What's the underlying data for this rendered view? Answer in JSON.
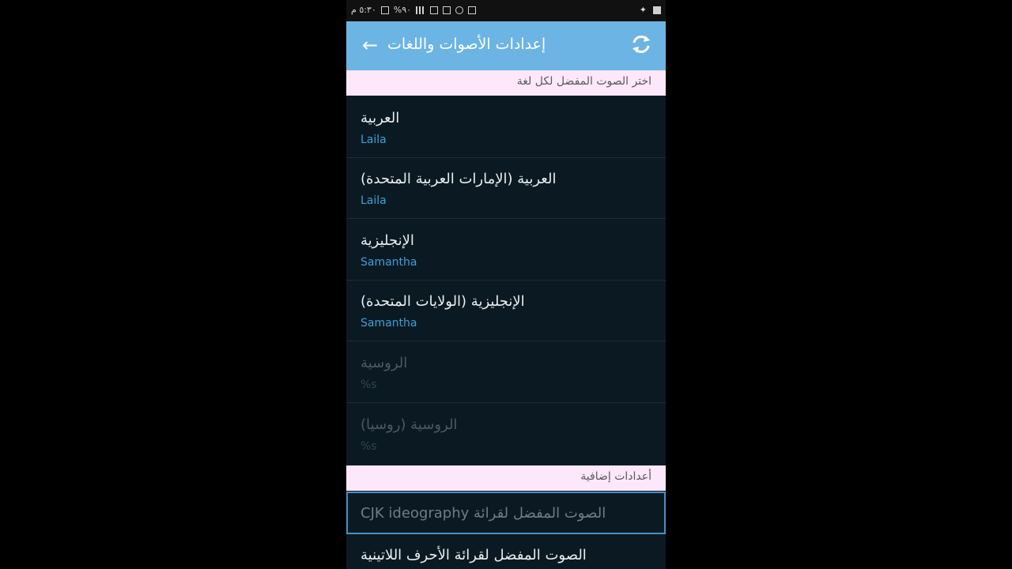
{
  "status_bar": {
    "time": "٥:٣٠ م",
    "battery": "%٩٠"
  },
  "app_bar": {
    "title": "إعدادات الأصوات واللغات",
    "back_icon": "arrow-left-icon",
    "refresh_icon": "refresh-icon"
  },
  "voice_section": {
    "header": "اختر الصوت المفضل لكل لغة",
    "items": [
      {
        "label": "العربية",
        "voice": "Laila",
        "enabled": true
      },
      {
        "label": "العربية (الإمارات العربية المتحدة)",
        "voice": "Laila",
        "enabled": true
      },
      {
        "label": "الإنجليزية",
        "voice": "Samantha",
        "enabled": true
      },
      {
        "label": "الإنجليزية (الولايات المتحدة)",
        "voice": "Samantha",
        "enabled": true
      },
      {
        "label": "الروسية",
        "voice": "%s",
        "enabled": false
      },
      {
        "label": "الروسية (روسيا)",
        "voice": "%s",
        "enabled": false
      }
    ]
  },
  "extra_section": {
    "header": "أعدادات إضافية",
    "cjk_item": "الصوت المفضل لقرائة CJK ideography",
    "latin_item": "الصوت المفضل لقرائة الأحرف اللاتينية"
  },
  "colors": {
    "app_bar": "#6cb4e3",
    "section_header_bg": "#fde7fb",
    "list_bg": "#0b1a22",
    "voice_text": "#3f9fd8",
    "focus_border": "#4a8fc4"
  }
}
